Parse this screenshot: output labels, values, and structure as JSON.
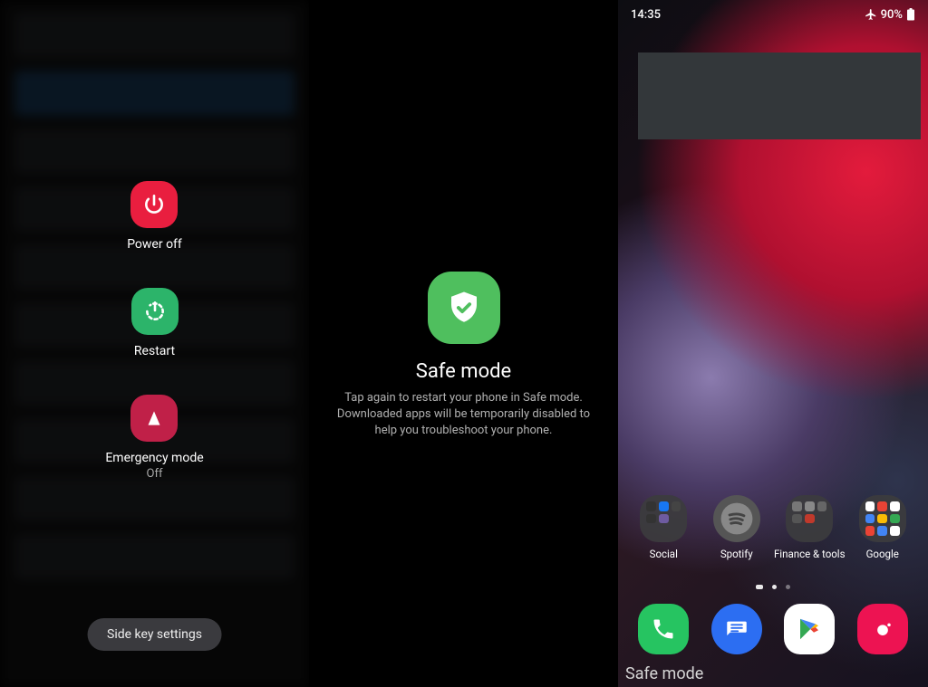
{
  "left": {
    "power_off": "Power off",
    "restart": "Restart",
    "emergency": "Emergency mode",
    "emergency_state": "Off",
    "side_key": "Side key settings"
  },
  "mid": {
    "title": "Safe mode",
    "desc": "Tap again to restart your phone in Safe mode. Downloaded apps will be temporarily disabled to help you troubleshoot your phone."
  },
  "right": {
    "time": "14:35",
    "battery": "90%",
    "apps": {
      "social": "Social",
      "spotify": "Spotify",
      "finance": "Finance & tools",
      "google": "Google"
    },
    "safe_mode_badge": "Safe mode"
  }
}
